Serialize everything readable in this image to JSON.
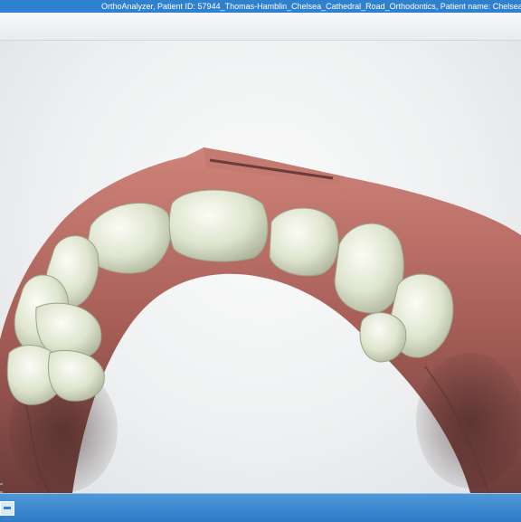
{
  "window": {
    "title": "OrthoAnalyzer, Patient ID: 57944_Thomas-Hamblin_Chelsea_Cathedral_Road_Orthodontics, Patient name: Chelsea Thomas-Hamblin"
  },
  "viewport": {
    "model": "upper-jaw-3d-scan-model"
  },
  "taskbar": {
    "items": [
      "app-taskbar-icon"
    ]
  },
  "colors": {
    "titlebar": "#2f81cf",
    "gingiva": "#b56a62",
    "teeth": "#dde3cc",
    "taskbar": "#3d8ad0"
  }
}
